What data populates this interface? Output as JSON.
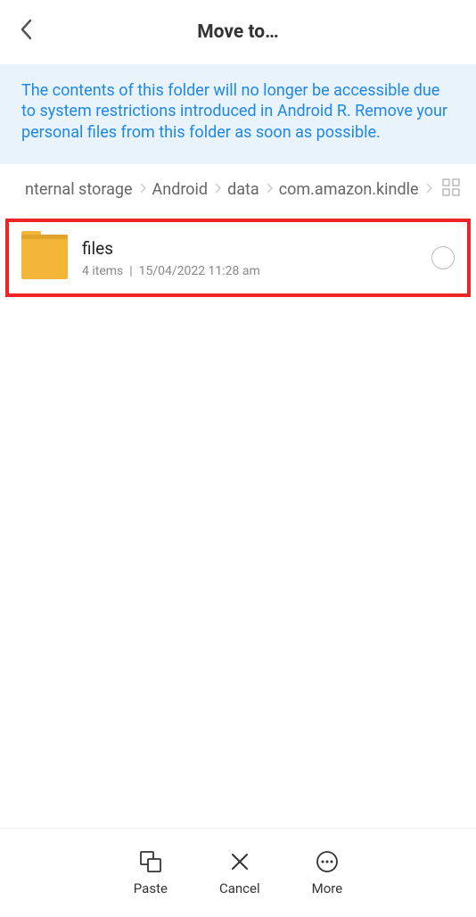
{
  "header": {
    "title": "Move to…"
  },
  "warning": "The contents of this folder will no longer be accessible due to system restrictions introduced in Android R. Remove your personal files from this folder as soon as possible.",
  "breadcrumb": {
    "segments": [
      "nternal storage",
      "Android",
      "data",
      "com.amazon.kindle"
    ]
  },
  "folders": [
    {
      "name": "files",
      "items_count": "4 items",
      "date": "15/04/2022 11:28 am"
    }
  ],
  "bottom_actions": {
    "paste": "Paste",
    "cancel": "Cancel",
    "more": "More"
  }
}
